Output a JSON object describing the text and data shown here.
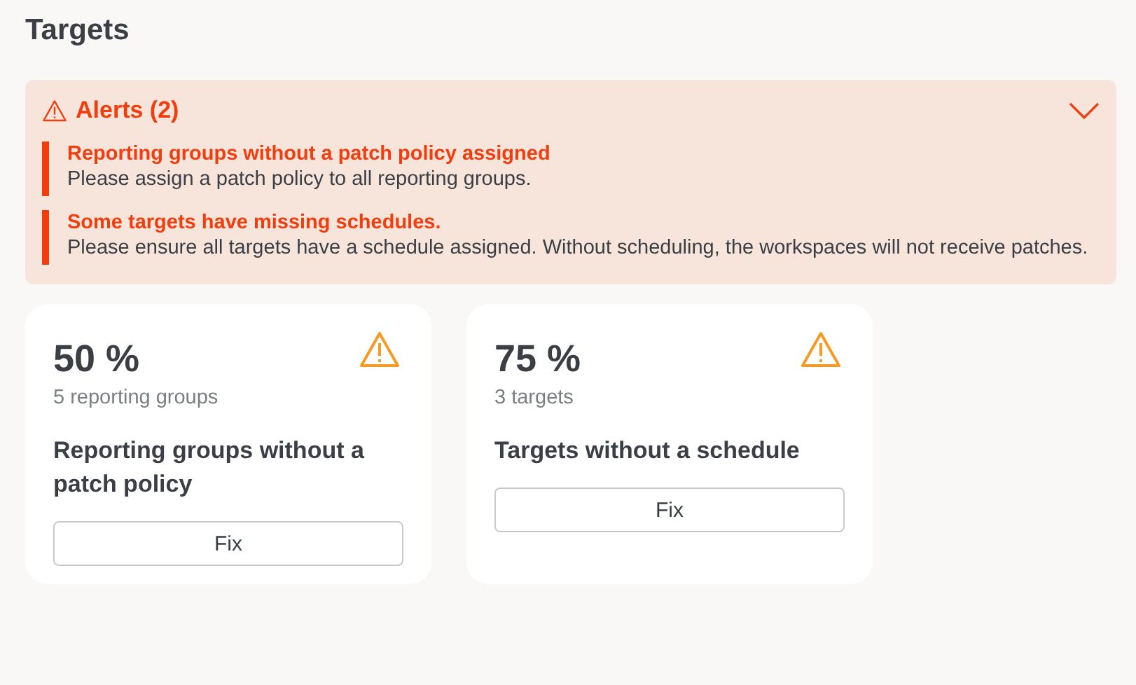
{
  "page": {
    "title": "Targets"
  },
  "alerts": {
    "title": "Alerts (2)",
    "expanded": true,
    "items": [
      {
        "title": "Reporting groups without a patch policy assigned",
        "message": "Please assign a patch policy to all reporting groups."
      },
      {
        "title": "Some targets have missing schedules.",
        "message": "Please ensure all targets have a schedule assigned. Without scheduling, the workspaces will not receive patches."
      }
    ]
  },
  "cards": [
    {
      "value": "50 %",
      "count": "5 reporting groups",
      "title": "Reporting groups without a patch policy",
      "button": "Fix"
    },
    {
      "value": "75 %",
      "count": "3 targets",
      "title": "Targets without a schedule",
      "button": "Fix"
    }
  ]
}
